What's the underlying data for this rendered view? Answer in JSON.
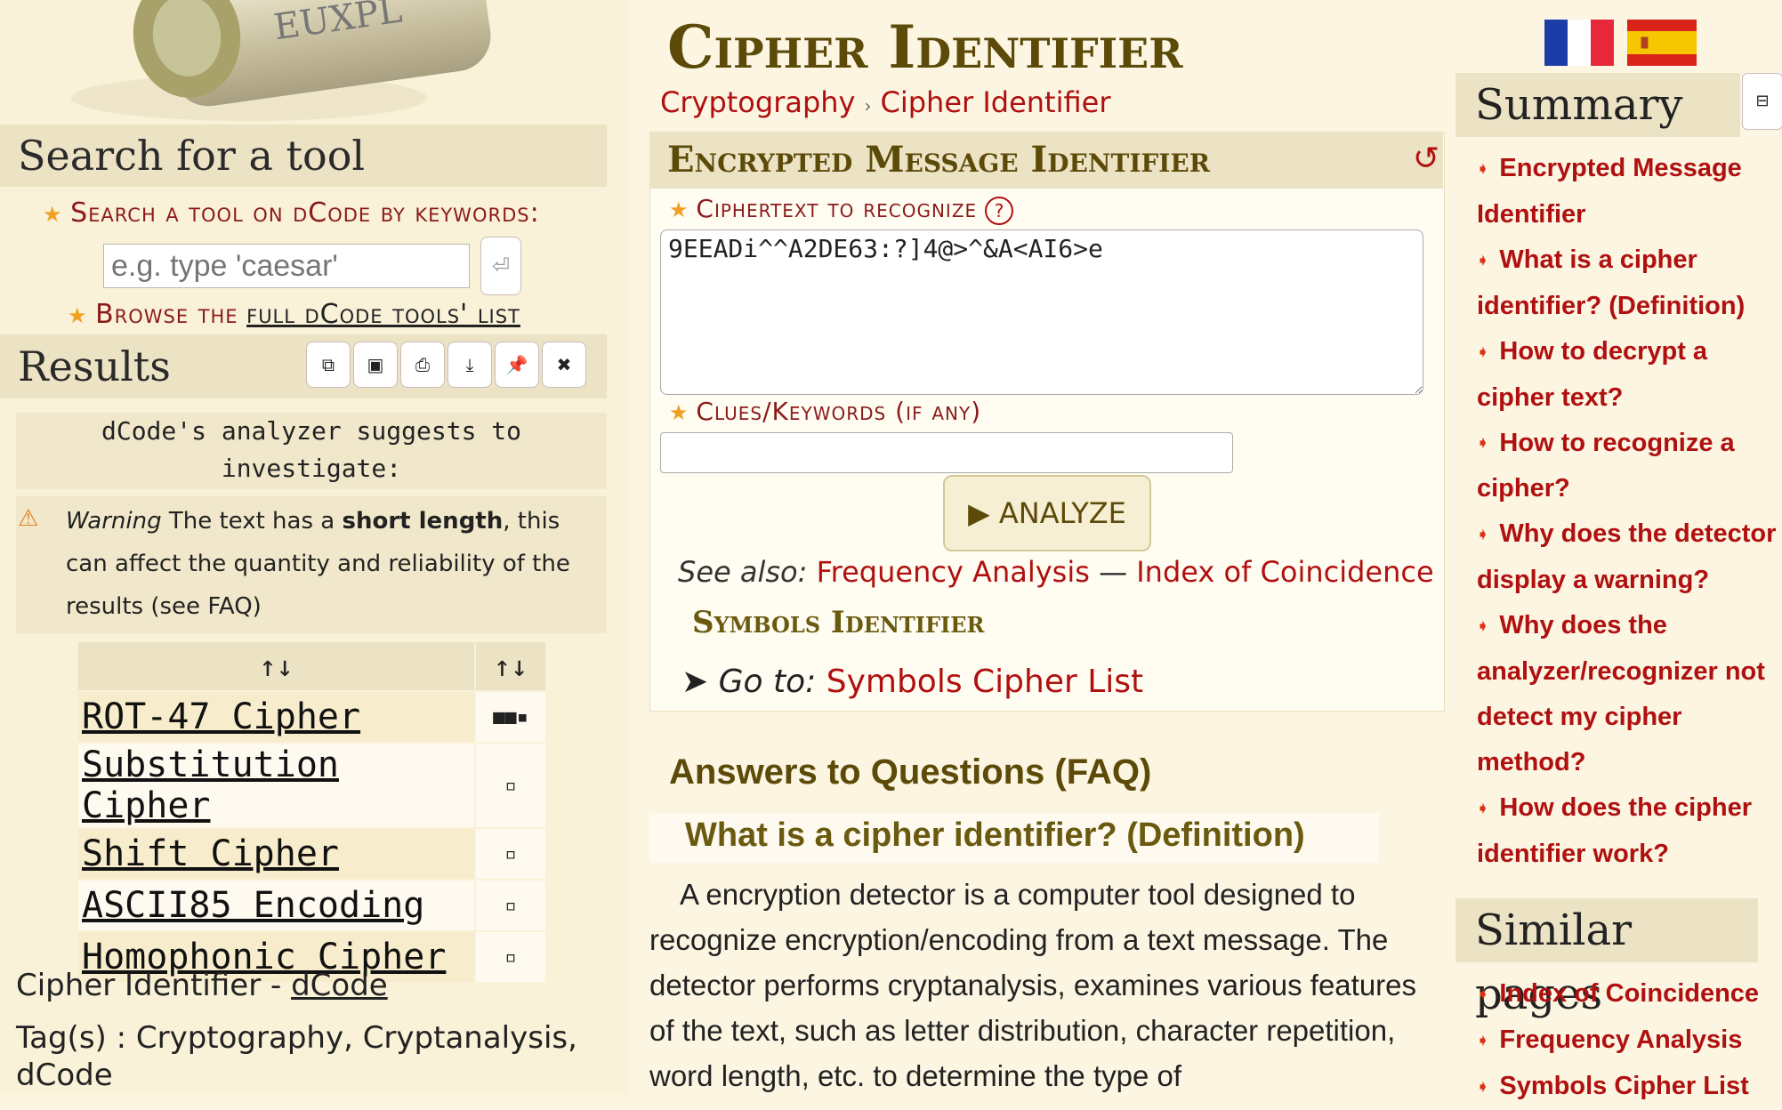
{
  "logo": {
    "letters": "EUXPL"
  },
  "sidebar": {
    "search_title": "Search for a tool",
    "search_label": "Search a tool on dCode by keywords:",
    "search_placeholder": "e.g. type 'caesar'",
    "search_go": "⏎",
    "browse_prefix": "Browse the",
    "browse_link": "full dCode tools' list",
    "results_title": "Results",
    "toolbar_icons": [
      "copy-icon",
      "save-icon",
      "print-icon",
      "download-icon",
      "pin-icon",
      "close-icon"
    ],
    "suggest_text": "dCode's analyzer suggests to investigate:",
    "warning_word": "Warning",
    "warning_text1": " The text has a ",
    "warning_bold": "short length",
    "warning_text2": ", this can affect the quantity and reliability of the results (see FAQ)",
    "table_headers": [
      "↑↓",
      "↑↓"
    ],
    "results": [
      {
        "name": "ROT-47 Cipher",
        "score": "■■▪"
      },
      {
        "name": "Substitution Cipher",
        "score": "▫"
      },
      {
        "name": "Shift Cipher",
        "score": "▫"
      },
      {
        "name": "ASCII85 Encoding",
        "score": "▫"
      },
      {
        "name": "Homophonic Cipher",
        "score": "▫"
      }
    ],
    "footer_prefix": "Cipher Identifier - ",
    "footer_link": "dCode",
    "tags": "Tag(s) : Cryptography, Cryptanalysis, dCode"
  },
  "main": {
    "title": "Cipher Identifier",
    "breadcrumb": [
      "Cryptography",
      "Cipher Identifier"
    ],
    "panel_title": "Encrypted Message Identifier",
    "ciphertext_label": "Ciphertext to recognize",
    "ciphertext_value": "9EEADi^^A2DE63:?]4@>^&A<AI6>e",
    "clues_label": "Clues/Keywords (if any)",
    "clues_value": "",
    "analyze_label": "▶ ANALYZE",
    "see_also_label": "See also:",
    "see_also_links": [
      "Frequency Analysis",
      "Index of Coincidence"
    ],
    "see_also_sep": " — ",
    "symbols_title": "Symbols Identifier",
    "goto_label": "Go to:",
    "goto_link": "Symbols Cipher List",
    "faq_title": "Answers to Questions (FAQ)",
    "faq_question": "What is a cipher identifier? (Definition)",
    "faq_answer": "A encryption detector is a computer tool designed to recognize encryption/encoding from a text message. The detector performs cryptanalysis, examines various features of the text, such as letter distribution, character repetition, word length, etc. to determine the type of"
  },
  "right": {
    "summary_title": "Summary",
    "summary_items": [
      "Encrypted Message Identifier",
      "What is a cipher identifier? (Definition)",
      "How to decrypt a cipher text?",
      "How to recognize a cipher?",
      "Why does the detector display a warning?",
      "Why does the analyzer/recognizer not detect my cipher method?",
      "How does the cipher identifier work?"
    ],
    "similar_title": "Similar pages",
    "similar_items": [
      "Index of Coincidence",
      "Frequency Analysis",
      "Symbols Cipher List"
    ]
  },
  "colors": {
    "link": "#b01010",
    "heading": "#5c4a08",
    "background": "#fbf5e2",
    "bar": "#ece2c4"
  }
}
